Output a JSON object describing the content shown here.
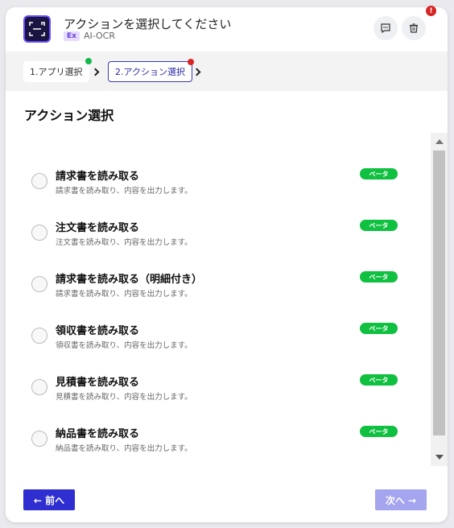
{
  "header": {
    "title": "アクションを選択してください",
    "ex_badge": "Ex",
    "app_name": "AI-OCR",
    "alert_count": "!"
  },
  "steps": [
    {
      "label": "1.アプリ選択",
      "status": "complete",
      "status_color": "#14b84a"
    },
    {
      "label": "2.アクション選択",
      "status": "error",
      "status_color": "#d62525"
    }
  ],
  "section_title": "アクション選択",
  "actions": [
    {
      "title": "請求書を読み取る",
      "desc": "請求書を読み取り、内容を出力します。",
      "badge": "ベータ",
      "selected": false
    },
    {
      "title": "注文書を読み取る",
      "desc": "注文書を読み取り、内容を出力します。",
      "badge": "ベータ",
      "selected": false
    },
    {
      "title": "請求書を読み取る（明細付き）",
      "desc": "請求書を読み取り、内容を出力します。",
      "badge": "ベータ",
      "selected": false
    },
    {
      "title": "領収書を読み取る",
      "desc": "領収書を読み取り、内容を出力します。",
      "badge": "ベータ",
      "selected": false
    },
    {
      "title": "見積書を読み取る",
      "desc": "見積書を読み取り、内容を出力します。",
      "badge": "ベータ",
      "selected": false
    },
    {
      "title": "納品書を読み取る",
      "desc": "納品書を読み取り、内容を出力します。",
      "badge": "ベータ",
      "selected": false
    }
  ],
  "footer": {
    "prev_label": "← 前へ",
    "next_label": "次へ →"
  },
  "colors": {
    "primary": "#2e2ed1",
    "primary_disabled": "#a5a4ef",
    "beta": "#10c040",
    "alert": "#d62525"
  },
  "icons": {
    "app": "scan-frame-icon",
    "comment": "comment-icon",
    "delete": "trash-icon"
  }
}
